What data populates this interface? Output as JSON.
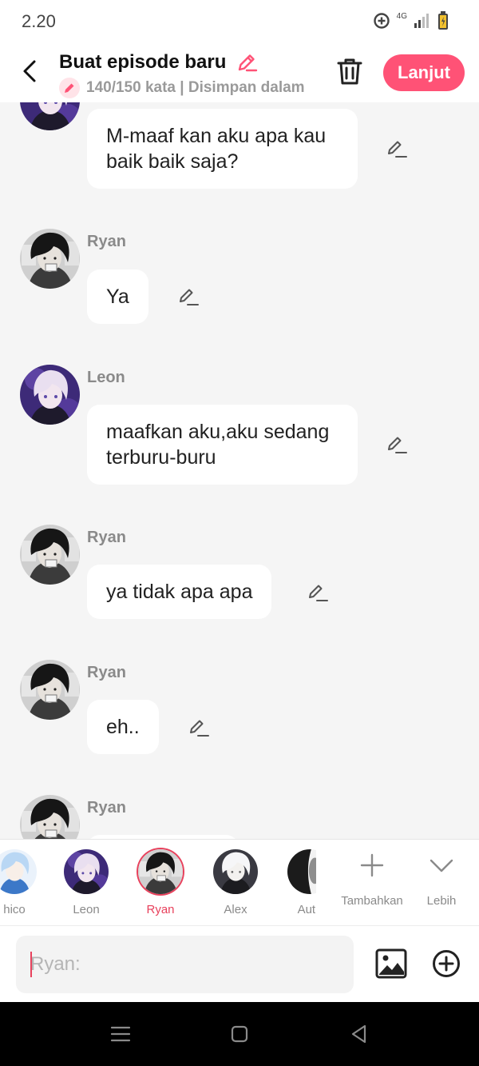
{
  "status_bar": {
    "time": "2.20",
    "network": "4G"
  },
  "header": {
    "title": "Buat episode baru",
    "subtitle": "140/150 kata | Disimpan dalam",
    "next_label": "Lanjut"
  },
  "colors": {
    "accent": "#ff5276",
    "selected": "#e8415c",
    "name_gray": "#8a8a8a",
    "background": "#f5f5f5"
  },
  "messages": [
    {
      "speaker": "",
      "text": "M-maaf kan aku apa kau baik baik saja?",
      "avatar": "leon"
    },
    {
      "speaker": "Ryan",
      "text": "Ya",
      "avatar": "ryan"
    },
    {
      "speaker": "Leon",
      "text": "maafkan aku,aku sedang terburu-buru",
      "avatar": "leon"
    },
    {
      "speaker": "Ryan",
      "text": "ya tidak apa apa",
      "avatar": "ryan"
    },
    {
      "speaker": "Ryan",
      "text": "eh..",
      "avatar": "ryan"
    },
    {
      "speaker": "Ryan",
      "text": "",
      "avatar": "ryan"
    }
  ],
  "characters": [
    {
      "name": "hico",
      "selected": false
    },
    {
      "name": "Leon",
      "selected": false
    },
    {
      "name": "Ryan",
      "selected": true
    },
    {
      "name": "Alex",
      "selected": false
    },
    {
      "name": "Auth",
      "selected": false
    }
  ],
  "char_actions": {
    "add_label": "Tambahkan",
    "more_label": "Lebih"
  },
  "composer": {
    "placeholder": "Ryan:"
  },
  "icons": [
    "back-icon",
    "trash-icon",
    "pencil-icon",
    "image-icon",
    "plus-circle-icon",
    "chevron-down-icon",
    "menu-icon",
    "home-icon",
    "back-triangle-icon"
  ]
}
